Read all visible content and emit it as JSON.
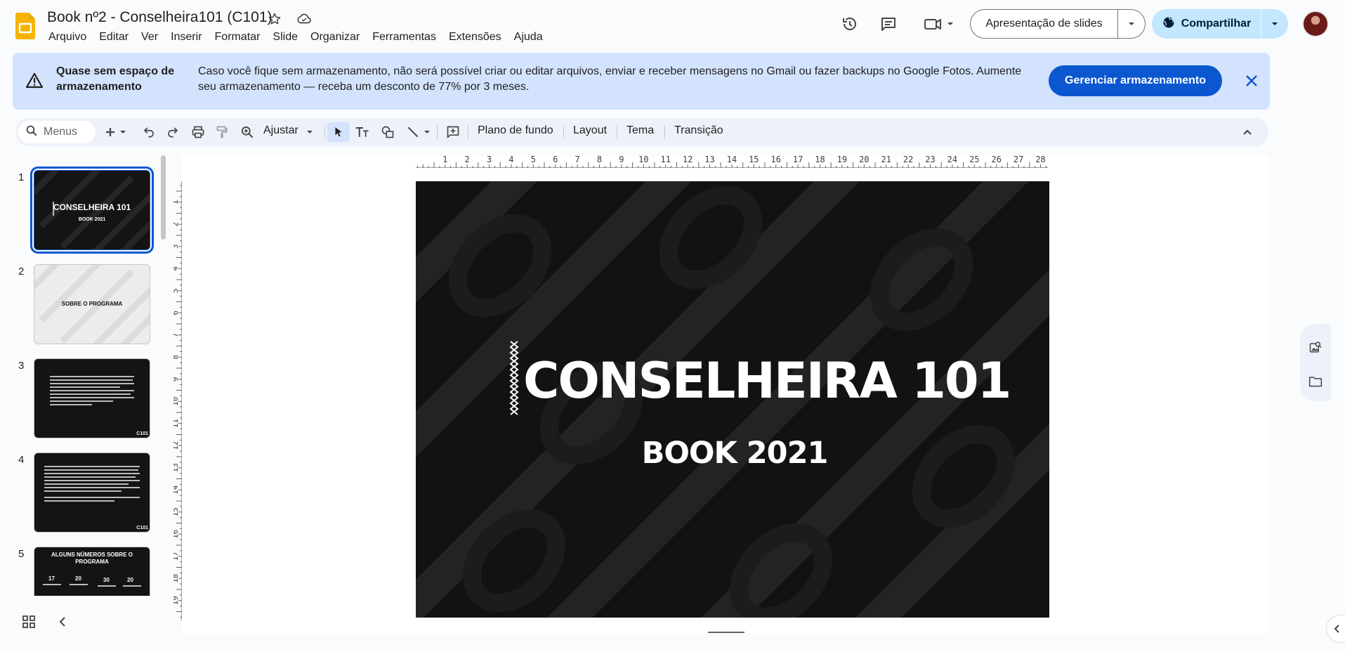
{
  "header": {
    "doc_title": "Book nº2 - Conselheira101 (C101)",
    "menu": [
      "Arquivo",
      "Editar",
      "Ver",
      "Inserir",
      "Formatar",
      "Slide",
      "Organizar",
      "Ferramentas",
      "Extensões",
      "Ajuda"
    ],
    "slideshow_label": "Apresentação de slides",
    "share_label": "Compartilhar"
  },
  "banner": {
    "title": "Quase sem espaço de armazenamento",
    "text": "Caso você fique sem armazenamento, não será possível criar ou editar arquivos, enviar e receber mensagens no Gmail ou fazer backups no Google Fotos. Aumente seu armazenamento — receba um desconto de 77% por 3 meses.",
    "cta_label": "Gerenciar armazenamento"
  },
  "toolbar": {
    "search_placeholder": "Menus",
    "zoom_label": "Ajustar",
    "background_label": "Plano de fundo",
    "layout_label": "Layout",
    "theme_label": "Tema",
    "transition_label": "Transição"
  },
  "filmstrip": {
    "slides": [
      {
        "number": "1",
        "title": "CONSELHEIRA 101",
        "subtitle": "BOOK 2021"
      },
      {
        "number": "2",
        "title": "SOBRE O PROGRAMA"
      },
      {
        "number": "3",
        "corner": "C101"
      },
      {
        "number": "4",
        "corner": "C101"
      },
      {
        "number": "5",
        "title": "ALGUNS NÚMEROS SOBRE O PROGRAMA",
        "stats": [
          "17",
          "20",
          "30",
          "20"
        ]
      }
    ]
  },
  "slide": {
    "title": "CONSELHEIRA 101",
    "subtitle": "BOOK 2021"
  },
  "ruler": {
    "h_labels": [
      "1",
      "2",
      "3",
      "4",
      "5",
      "6",
      "7",
      "8",
      "9",
      "10",
      "11",
      "12",
      "13",
      "14",
      "15",
      "16",
      "17",
      "18",
      "19",
      "20",
      "21",
      "22",
      "23",
      "24",
      "25",
      "26",
      "27",
      "28"
    ],
    "v_labels": [
      "1",
      "2",
      "3",
      "4",
      "5",
      "6",
      "7",
      "8",
      "9",
      "10",
      "11",
      "12",
      "13",
      "14",
      "15",
      "16",
      "17",
      "18",
      "19"
    ]
  },
  "colors": {
    "accent": "#0b57d0",
    "banner_bg": "#d3e3fd",
    "share_bg": "#c2e7ff",
    "slides_logo": "#f6b400"
  }
}
